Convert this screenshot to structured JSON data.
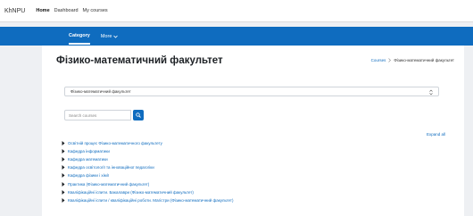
{
  "topnav": {
    "brand": "KhNPU",
    "links": [
      {
        "label": "Home"
      },
      {
        "label": "Dashboard"
      },
      {
        "label": "My courses"
      }
    ]
  },
  "secondary_nav": {
    "category_label": "Category",
    "more_label": "More"
  },
  "page": {
    "title": "Фізико-математичний факультет",
    "breadcrumb": {
      "parent": "Courses",
      "current": "Фізико-математичний факультет"
    }
  },
  "category_select": {
    "value": "Фізико-математичний факультет"
  },
  "search": {
    "placeholder": "Search courses"
  },
  "expand_all_label": "Expand all",
  "categories": [
    {
      "label": "Освітній процес Фізико-математичного факультету"
    },
    {
      "label": "Кафедра інформатики"
    },
    {
      "label": "Кафедра математики"
    },
    {
      "label": "Кафедра освітології та інноваційної педагогіки"
    },
    {
      "label": "Кафедра фізики і хімії"
    },
    {
      "label": "Практика (Фізико-математичний факультет)"
    },
    {
      "label": "Кваліфікаційні іспити. Бакалаври (Фізико-математичний факультет)"
    },
    {
      "label": "Кваліфікаційні іспити / кваліфікаційні роботи. Магістри (Фізико-математичний факультет)"
    }
  ],
  "colors": {
    "accent": "#0f6cbf",
    "background": "#eef0f3"
  }
}
